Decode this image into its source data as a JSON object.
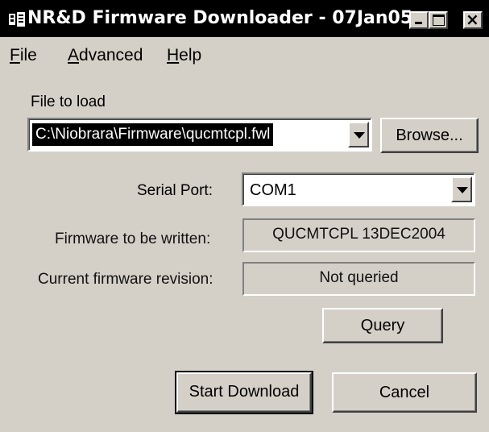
{
  "window": {
    "title": "NR&D Firmware Downloader - 07Jan05",
    "icon": "app-icon",
    "controls": {
      "minimize_icon": "minimize-icon",
      "maximize_icon": "maximize-icon",
      "close_glyph": "×",
      "close_icon": "close-icon"
    }
  },
  "menu": {
    "file": {
      "mnemonic": "F",
      "rest": "ile"
    },
    "advanced": {
      "mnemonic": "A",
      "rest": "dvanced"
    },
    "help": {
      "mnemonic": "H",
      "rest": "elp"
    }
  },
  "form": {
    "file_label": "File to load",
    "file_value": "C:\\Niobrara\\Firmware\\qucmtcpl.fwl",
    "browse_label": "Browse...",
    "serial_label": "Serial Port:",
    "serial_value": "COM1",
    "fw_written_label": "Firmware to be written:",
    "fw_written_value": "QUCMTCPL 13DEC2004",
    "fw_current_label": "Current firmware revision:",
    "fw_current_value": "Not queried"
  },
  "buttons": {
    "query": "Query",
    "start_download": "Start Download",
    "cancel": "Cancel"
  },
  "colors": {
    "face": "#d4d0c8",
    "titlebar": "#000000",
    "selection": "#000000"
  }
}
